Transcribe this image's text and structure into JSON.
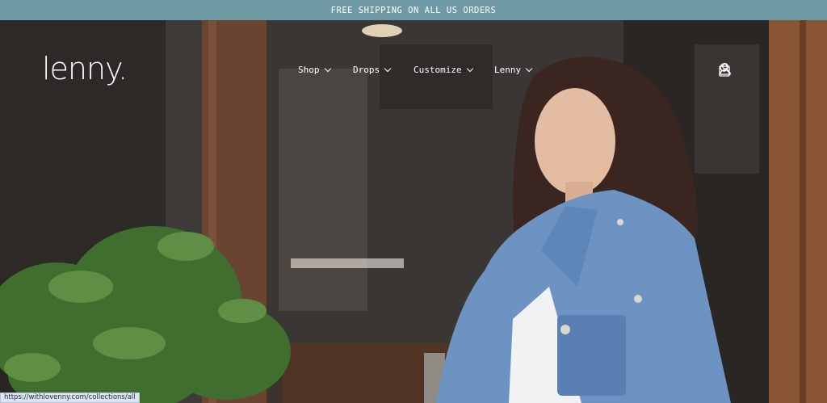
{
  "announcement": {
    "text": "FREE SHIPPING ON ALL US ORDERS"
  },
  "brand": {
    "logo": "lenny."
  },
  "nav": {
    "items": [
      {
        "label": "Shop"
      },
      {
        "label": "Drops"
      },
      {
        "label": "Customize"
      },
      {
        "label": "Lenny"
      }
    ]
  },
  "header_icons": [
    "account-icon",
    "search-icon",
    "cart-icon"
  ],
  "status": {
    "url": "https://withlovenny.com/collections/all"
  },
  "colors": {
    "announcement_bg": "#6f9aa5",
    "text": "#ffffff"
  }
}
